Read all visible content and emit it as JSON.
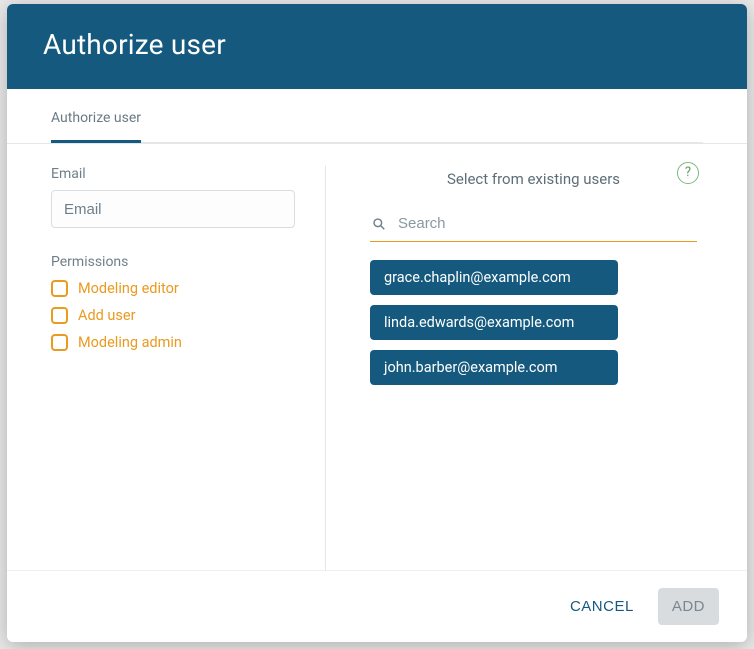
{
  "dialog": {
    "title": "Authorize user"
  },
  "tabs": {
    "active": "Authorize user"
  },
  "form": {
    "email_label": "Email",
    "email_placeholder": "Email",
    "permissions_label": "Permissions",
    "permissions": [
      {
        "label": "Modeling editor",
        "checked": false
      },
      {
        "label": "Add user",
        "checked": false
      },
      {
        "label": "Modeling admin",
        "checked": false
      }
    ]
  },
  "existing": {
    "title": "Select from existing users",
    "help_icon": "?",
    "search_placeholder": "Search",
    "users": [
      "grace.chaplin@example.com",
      "linda.edwards@example.com",
      "john.barber@example.com"
    ]
  },
  "footer": {
    "cancel": "CANCEL",
    "add": "ADD"
  }
}
